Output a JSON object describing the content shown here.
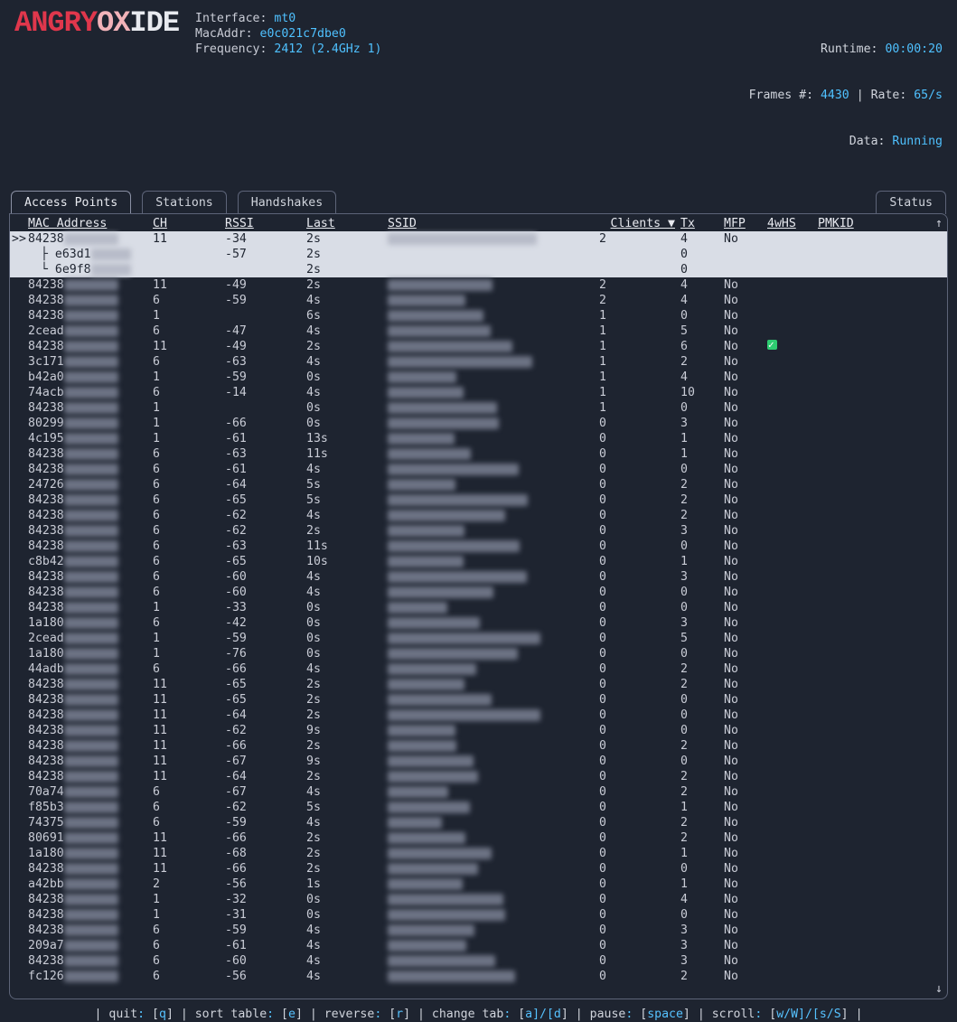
{
  "logo": {
    "part1": "ANGRY",
    "part2": "OX",
    "part3": "IDE"
  },
  "header": {
    "interface_label": "Interface:",
    "interface_value": "mt0",
    "mac_label": "MacAddr:",
    "mac_value": "e0c021c7dbe0",
    "freq_label": "Frequency:",
    "freq_value": "2412 (2.4GHz 1)",
    "runtime_label": "Runtime:",
    "runtime_value": "00:00:20",
    "frames_label": "Frames #:",
    "frames_value": "4430",
    "rate_sep": " | ",
    "rate_label": "Rate:",
    "rate_value": "65/s",
    "data_label": "Data:",
    "data_value": "Running"
  },
  "tabs": {
    "ap": "Access Points",
    "stations": "Stations",
    "handshakes": "Handshakes",
    "status": "Status"
  },
  "columns": {
    "mac": "MAC Address",
    "ch": "CH",
    "rssi": "RSSI",
    "last": "Last",
    "ssid": "SSID",
    "clients": "Clients ▼",
    "tx": "Tx",
    "mfp": "MFP",
    "fourhs": "4wHS",
    "pmkid": "PMKID"
  },
  "selector": ">>",
  "tree_mid": "├",
  "tree_end": "└",
  "rows": [
    {
      "sel": true,
      "mac": "84238",
      "ch": "11",
      "rssi": "-34",
      "last": "2s",
      "clients": "2",
      "tx": "4",
      "mfp": "No",
      "fourhs": "",
      "pmkid": ""
    },
    {
      "sel": true,
      "child": true,
      "mac": "e63d1",
      "ch": "",
      "rssi": "-57",
      "last": "2s",
      "clients": "",
      "tx": "0",
      "mfp": "",
      "fourhs": "",
      "pmkid": ""
    },
    {
      "sel": true,
      "child": true,
      "last_child": true,
      "mac": "6e9f8",
      "ch": "",
      "rssi": "",
      "last": "2s",
      "clients": "",
      "tx": "0",
      "mfp": "",
      "fourhs": "",
      "pmkid": ""
    },
    {
      "mac": "84238",
      "ch": "11",
      "rssi": "-49",
      "last": "2s",
      "clients": "2",
      "tx": "4",
      "mfp": "No"
    },
    {
      "mac": "84238",
      "ch": "6",
      "rssi": "-59",
      "last": "4s",
      "clients": "2",
      "tx": "4",
      "mfp": "No"
    },
    {
      "mac": "84238",
      "ch": "1",
      "rssi": "",
      "last": "6s",
      "clients": "1",
      "tx": "0",
      "mfp": "No"
    },
    {
      "mac": "2cead",
      "ch": "6",
      "rssi": "-47",
      "last": "4s",
      "clients": "1",
      "tx": "5",
      "mfp": "No"
    },
    {
      "mac": "84238",
      "ch": "11",
      "rssi": "-49",
      "last": "2s",
      "clients": "1",
      "tx": "6",
      "mfp": "No",
      "fourhs": "✓"
    },
    {
      "mac": "3c171",
      "ch": "6",
      "rssi": "-63",
      "last": "4s",
      "clients": "1",
      "tx": "2",
      "mfp": "No"
    },
    {
      "mac": "b42a0",
      "ch": "1",
      "rssi": "-59",
      "last": "0s",
      "clients": "1",
      "tx": "4",
      "mfp": "No"
    },
    {
      "mac": "74acb",
      "ch": "6",
      "rssi": "-14",
      "last": "4s",
      "clients": "1",
      "tx": "10",
      "mfp": "No"
    },
    {
      "mac": "84238",
      "ch": "1",
      "rssi": "",
      "last": "0s",
      "clients": "1",
      "tx": "0",
      "mfp": "No"
    },
    {
      "mac": "80299",
      "ch": "1",
      "rssi": "-66",
      "last": "0s",
      "clients": "0",
      "tx": "3",
      "mfp": "No"
    },
    {
      "mac": "4c195",
      "ch": "1",
      "rssi": "-61",
      "last": "13s",
      "clients": "0",
      "tx": "1",
      "mfp": "No"
    },
    {
      "mac": "84238",
      "ch": "6",
      "rssi": "-63",
      "last": "11s",
      "clients": "0",
      "tx": "1",
      "mfp": "No"
    },
    {
      "mac": "84238",
      "ch": "6",
      "rssi": "-61",
      "last": "4s",
      "clients": "0",
      "tx": "0",
      "mfp": "No"
    },
    {
      "mac": "24726",
      "ch": "6",
      "rssi": "-64",
      "last": "5s",
      "clients": "0",
      "tx": "2",
      "mfp": "No"
    },
    {
      "mac": "84238",
      "ch": "6",
      "rssi": "-65",
      "last": "5s",
      "clients": "0",
      "tx": "2",
      "mfp": "No"
    },
    {
      "mac": "84238",
      "ch": "6",
      "rssi": "-62",
      "last": "4s",
      "clients": "0",
      "tx": "2",
      "mfp": "No"
    },
    {
      "mac": "84238",
      "ch": "6",
      "rssi": "-62",
      "last": "2s",
      "clients": "0",
      "tx": "3",
      "mfp": "No"
    },
    {
      "mac": "84238",
      "ch": "6",
      "rssi": "-63",
      "last": "11s",
      "clients": "0",
      "tx": "0",
      "mfp": "No"
    },
    {
      "mac": "c8b42",
      "ch": "6",
      "rssi": "-65",
      "last": "10s",
      "clients": "0",
      "tx": "1",
      "mfp": "No"
    },
    {
      "mac": "84238",
      "ch": "6",
      "rssi": "-60",
      "last": "4s",
      "clients": "0",
      "tx": "3",
      "mfp": "No"
    },
    {
      "mac": "84238",
      "ch": "6",
      "rssi": "-60",
      "last": "4s",
      "clients": "0",
      "tx": "0",
      "mfp": "No"
    },
    {
      "mac": "84238",
      "ch": "1",
      "rssi": "-33",
      "last": "0s",
      "clients": "0",
      "tx": "0",
      "mfp": "No"
    },
    {
      "mac": "1a180",
      "ch": "6",
      "rssi": "-42",
      "last": "0s",
      "clients": "0",
      "tx": "3",
      "mfp": "No"
    },
    {
      "mac": "2cead",
      "ch": "1",
      "rssi": "-59",
      "last": "0s",
      "clients": "0",
      "tx": "5",
      "mfp": "No"
    },
    {
      "mac": "1a180",
      "ch": "1",
      "rssi": "-76",
      "last": "0s",
      "clients": "0",
      "tx": "0",
      "mfp": "No"
    },
    {
      "mac": "44adb",
      "ch": "6",
      "rssi": "-66",
      "last": "4s",
      "clients": "0",
      "tx": "2",
      "mfp": "No"
    },
    {
      "mac": "84238",
      "ch": "11",
      "rssi": "-65",
      "last": "2s",
      "clients": "0",
      "tx": "2",
      "mfp": "No"
    },
    {
      "mac": "84238",
      "ch": "11",
      "rssi": "-65",
      "last": "2s",
      "clients": "0",
      "tx": "0",
      "mfp": "No"
    },
    {
      "mac": "84238",
      "ch": "11",
      "rssi": "-64",
      "last": "2s",
      "clients": "0",
      "tx": "0",
      "mfp": "No"
    },
    {
      "mac": "84238",
      "ch": "11",
      "rssi": "-62",
      "last": "9s",
      "clients": "0",
      "tx": "0",
      "mfp": "No"
    },
    {
      "mac": "84238",
      "ch": "11",
      "rssi": "-66",
      "last": "2s",
      "clients": "0",
      "tx": "2",
      "mfp": "No"
    },
    {
      "mac": "84238",
      "ch": "11",
      "rssi": "-67",
      "last": "9s",
      "clients": "0",
      "tx": "0",
      "mfp": "No"
    },
    {
      "mac": "84238",
      "ch": "11",
      "rssi": "-64",
      "last": "2s",
      "clients": "0",
      "tx": "2",
      "mfp": "No"
    },
    {
      "mac": "70a74",
      "ch": "6",
      "rssi": "-67",
      "last": "4s",
      "clients": "0",
      "tx": "2",
      "mfp": "No"
    },
    {
      "mac": "f85b3",
      "ch": "6",
      "rssi": "-62",
      "last": "5s",
      "clients": "0",
      "tx": "1",
      "mfp": "No"
    },
    {
      "mac": "74375",
      "ch": "6",
      "rssi": "-59",
      "last": "4s",
      "clients": "0",
      "tx": "2",
      "mfp": "No"
    },
    {
      "mac": "80691",
      "ch": "11",
      "rssi": "-66",
      "last": "2s",
      "clients": "0",
      "tx": "2",
      "mfp": "No"
    },
    {
      "mac": "1a180",
      "ch": "11",
      "rssi": "-68",
      "last": "2s",
      "clients": "0",
      "tx": "1",
      "mfp": "No"
    },
    {
      "mac": "84238",
      "ch": "11",
      "rssi": "-66",
      "last": "2s",
      "clients": "0",
      "tx": "0",
      "mfp": "No"
    },
    {
      "mac": "a42bb",
      "ch": "2",
      "rssi": "-56",
      "last": "1s",
      "clients": "0",
      "tx": "1",
      "mfp": "No"
    },
    {
      "mac": "84238",
      "ch": "1",
      "rssi": "-32",
      "last": "0s",
      "clients": "0",
      "tx": "4",
      "mfp": "No"
    },
    {
      "mac": "84238",
      "ch": "1",
      "rssi": "-31",
      "last": "0s",
      "clients": "0",
      "tx": "0",
      "mfp": "No"
    },
    {
      "mac": "84238",
      "ch": "6",
      "rssi": "-59",
      "last": "4s",
      "clients": "0",
      "tx": "3",
      "mfp": "No"
    },
    {
      "mac": "209a7",
      "ch": "6",
      "rssi": "-61",
      "last": "4s",
      "clients": "0",
      "tx": "3",
      "mfp": "No"
    },
    {
      "mac": "84238",
      "ch": "6",
      "rssi": "-60",
      "last": "4s",
      "clients": "0",
      "tx": "3",
      "mfp": "No"
    },
    {
      "mac": "fc126",
      "ch": "6",
      "rssi": "-56",
      "last": "4s",
      "clients": "0",
      "tx": "2",
      "mfp": "No"
    }
  ],
  "scroll": {
    "up": "↑",
    "down": "↓"
  },
  "footer": {
    "quit_lbl": "quit",
    "quit_key": "q",
    "sort_lbl": "sort table",
    "sort_key": "e",
    "rev_lbl": "reverse",
    "rev_key": "r",
    "tab_lbl": "change tab",
    "tab_key": "a]/[d",
    "pause_lbl": "pause",
    "pause_key": "space",
    "scroll_lbl": "scroll",
    "scroll_key": "w/W]/[s/S"
  }
}
